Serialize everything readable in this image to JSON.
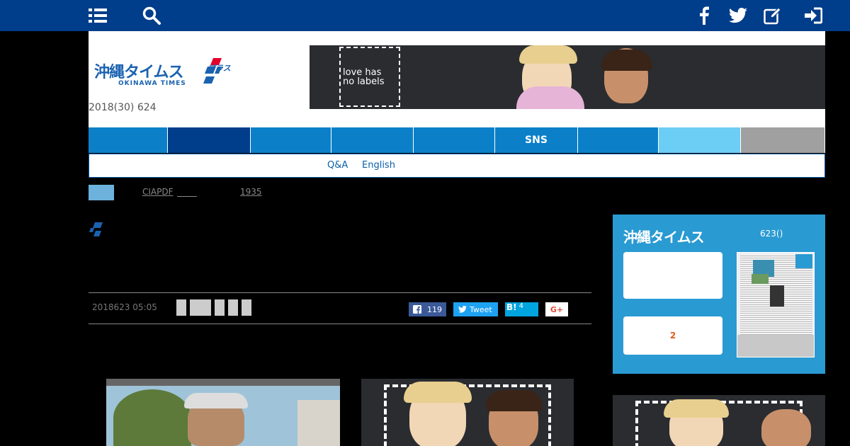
{
  "topbar": {
    "icons": [
      "menu-list-icon",
      "search-icon",
      "facebook-icon",
      "twitter-icon",
      "edit-icon",
      "login-icon"
    ],
    "bg_color": "#003d8a"
  },
  "header": {
    "logo_jp": "沖縄タイムス",
    "logo_plus": "プラス",
    "logo_en": "OKINAWA TIMES",
    "date_text": "2018(30) 624",
    "banner_slogan": "love has no labels"
  },
  "nav": {
    "items": [
      {
        "label": "",
        "color": "#0b80c9"
      },
      {
        "label": "",
        "color": "#003d8a"
      },
      {
        "label": "",
        "color": "#0b80c9"
      },
      {
        "label": "",
        "color": "#0b80c9"
      },
      {
        "label": "",
        "color": "#0b80c9"
      },
      {
        "label": "SNS",
        "color": "#0b80c9"
      },
      {
        "label": "",
        "color": "#0b80c9"
      },
      {
        "label": "",
        "color": "#6ccdf5"
      },
      {
        "label": "",
        "color": "#a0a0a0"
      }
    ]
  },
  "subnav": {
    "qa": "Q&A",
    "english": "English"
  },
  "tags": {
    "first": "CIAPDF",
    "second": "1935"
  },
  "article": {
    "date": "2018623 05:05",
    "share": {
      "facebook_count": "119",
      "tweet_label": "Tweet",
      "hatena_label": "B!",
      "hatena_count": "4",
      "gplus_label": "G+"
    }
  },
  "sidebar": {
    "title": "沖縄タイムス",
    "date": "623()",
    "box2_text": "2"
  }
}
